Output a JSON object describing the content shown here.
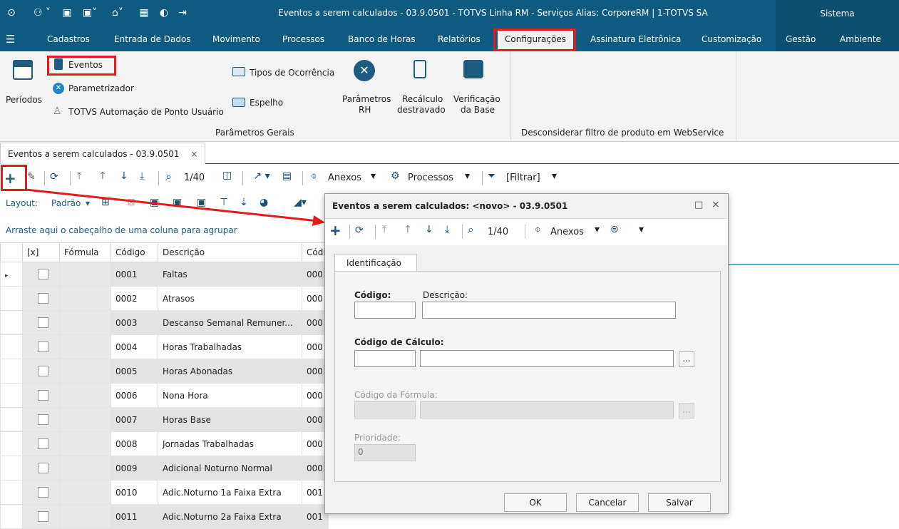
{
  "window_title": "Eventos a serem calculados - 03.9.0501 - TOTVS Linha RM - Serviços  Alias: CorporeRM | 1-TOTVS SA",
  "sistema": "Sistema",
  "menu": {
    "cadastros": "Cadastros",
    "entrada": "Entrada de Dados",
    "movimento": "Movimento",
    "processos": "Processos",
    "banco": "Banco de Horas",
    "relatorios": "Relatórios",
    "config": "Configurações",
    "assinatura": "Assinatura Eletrônica",
    "custom": "Customização",
    "gestao": "Gestão",
    "ambiente": "Ambiente"
  },
  "ribbon": {
    "periodos": "Períodos",
    "eventos": "Eventos",
    "parametrizador": "Parametrizador",
    "automacao": "TOTVS Automação de Ponto Usuário",
    "tipos": "Tipos de Ocorrência",
    "espelho": "Espelho",
    "param_rh_1": "Parâmetros",
    "param_rh_2": "RH",
    "recalc_1": "Recálculo",
    "recalc_2": "destravado",
    "verif_1": "Verificação",
    "verif_2": "da Base",
    "group1": "Parâmetros Gerais",
    "group2": "Desconsiderar filtro de produto em WebService"
  },
  "doc_tab": "Eventos a serem calculados - 03.9.0501",
  "doc_tab_close": "×",
  "toolbar": {
    "count": "1/40",
    "anexos": "Anexos",
    "processos": "Processos",
    "filtrar": "[Filtrar]"
  },
  "toolbar2": {
    "layout": "Layout:",
    "padrao": "Padrão"
  },
  "group_hint": "Arraste aqui o cabeçalho de uma coluna para agrupar",
  "grid": {
    "headers": [
      "[x]",
      "Fórmula",
      "Código",
      "Descrição",
      "Códi"
    ],
    "rows": [
      {
        "codigo": "0001",
        "descricao": "Faltas",
        "codc": "000"
      },
      {
        "codigo": "0002",
        "descricao": "Atrasos",
        "codc": "000"
      },
      {
        "codigo": "0003",
        "descricao": "Descanso Semanal Remuner...",
        "codc": "000"
      },
      {
        "codigo": "0004",
        "descricao": "Horas Trabalhadas",
        "codc": "000"
      },
      {
        "codigo": "0005",
        "descricao": "Horas Abonadas",
        "codc": "000"
      },
      {
        "codigo": "0006",
        "descricao": "Nona Hora",
        "codc": "000"
      },
      {
        "codigo": "0007",
        "descricao": "Horas Base",
        "codc": "000"
      },
      {
        "codigo": "0008",
        "descricao": "Jornadas Trabalhadas",
        "codc": "000"
      },
      {
        "codigo": "0009",
        "descricao": "Adicional Noturno Normal",
        "codc": "000"
      },
      {
        "codigo": "0010",
        "descricao": "Adic.Noturno 1a Faixa Extra",
        "codc": "001"
      },
      {
        "codigo": "0011",
        "descricao": "Adic.Noturno 2a Faixa Extra",
        "codc": "001"
      }
    ]
  },
  "modal": {
    "title": "Eventos a serem calculados: <novo> - 03.9.0501",
    "count": "1/40",
    "anexos": "Anexos",
    "tab": "Identificacao",
    "tab_label": "Identificação",
    "codigo": "Código:",
    "descricao": "Descrição:",
    "codigo_calculo": "Código de Cálculo:",
    "codigo_formula": "Código da Fórmula:",
    "prioridade": "Prioridade:",
    "prioridade_val": "0",
    "ellipsis": "...",
    "ok": "OK",
    "cancelar": "Cancelar",
    "salvar": "Salvar"
  }
}
